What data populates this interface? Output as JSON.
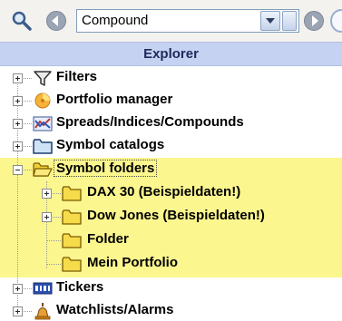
{
  "toolbar": {
    "search_value": "Compound",
    "icons": [
      "search-icon",
      "back-icon",
      "dropdown-icon",
      "go-icon",
      "more-icon"
    ]
  },
  "explorer": {
    "title": "Explorer",
    "tree": [
      {
        "label": "Filters",
        "icon": "filter-icon",
        "expanded": false
      },
      {
        "label": "Portfolio manager",
        "icon": "portfolio-icon",
        "expanded": false
      },
      {
        "label": "Spreads/Indices/Compounds",
        "icon": "chart-icon",
        "expanded": false
      },
      {
        "label": "Symbol catalogs",
        "icon": "folder-icon",
        "expanded": false
      },
      {
        "label": "Symbol folders",
        "icon": "folder-open-icon",
        "expanded": true,
        "selected": true,
        "children": [
          {
            "label": "DAX 30 (Beispieldaten!)",
            "icon": "folder-icon",
            "expanded": false
          },
          {
            "label": "Dow Jones (Beispieldaten!)",
            "icon": "folder-icon",
            "expanded": false
          },
          {
            "label": "Folder",
            "icon": "folder-icon"
          },
          {
            "label": "Mein Portfolio",
            "icon": "folder-icon"
          }
        ]
      },
      {
        "label": "Tickers",
        "icon": "ticker-icon",
        "expanded": false
      },
      {
        "label": "Watchlists/Alarms",
        "icon": "alarm-bell-icon",
        "expanded": false
      }
    ]
  },
  "colors": {
    "header_bg": "#c6d2f2",
    "highlight_bg": "#fbf68e",
    "folder_yellow": "#f6dc4a"
  }
}
